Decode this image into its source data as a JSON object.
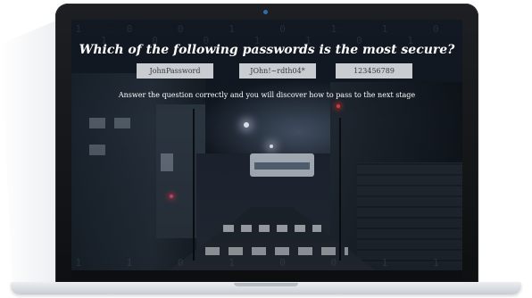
{
  "quiz": {
    "question": "Which of the following passwords is the most secure?",
    "options": [
      "JohnPassword",
      "JOhn!~rdth04*",
      "123456789"
    ],
    "hint": "Answer the question correctly and you will discover how to pass to the next stage"
  },
  "decor": {
    "binary_rows": [
      "1 0 0 1 0 1 1 0 1 0 0 1 1 0 1",
      "1 1 0 1 0 0 1 1 0 1 0 1 0"
    ]
  },
  "colors": {
    "option_bg": "#c9cdd2",
    "text": "#ffffff",
    "laptop_frame": "#1d1f22"
  }
}
